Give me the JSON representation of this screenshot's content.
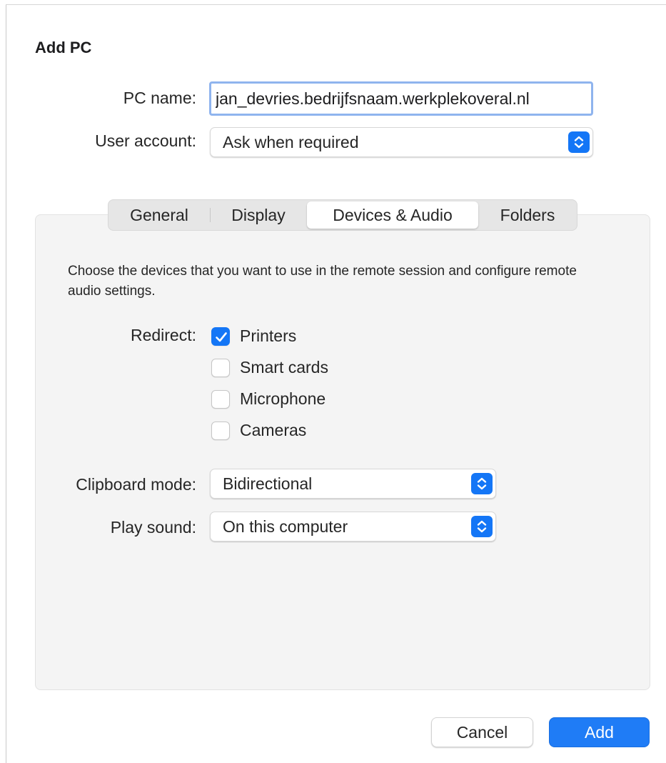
{
  "dialog": {
    "title": "Add PC"
  },
  "pc_name": {
    "label": "PC name:",
    "value": "jan_devries.bedrijfsnaam.werkplekoveral.nl"
  },
  "user_account": {
    "label": "User account:",
    "value": "Ask when required"
  },
  "tabs": [
    {
      "label": "General",
      "active": false
    },
    {
      "label": "Display",
      "active": false
    },
    {
      "label": "Devices & Audio",
      "active": true
    },
    {
      "label": "Folders",
      "active": false
    }
  ],
  "devices": {
    "description": "Choose the devices that you want to use in the remote session and configure remote audio settings.",
    "redirect_label": "Redirect:",
    "options": [
      {
        "label": "Printers",
        "checked": true
      },
      {
        "label": "Smart cards",
        "checked": false
      },
      {
        "label": "Microphone",
        "checked": false
      },
      {
        "label": "Cameras",
        "checked": false
      }
    ],
    "clipboard": {
      "label": "Clipboard mode:",
      "value": "Bidirectional"
    },
    "sound": {
      "label": "Play sound:",
      "value": "On this computer"
    }
  },
  "buttons": {
    "cancel": "Cancel",
    "add": "Add"
  },
  "colors": {
    "accent": "#1476f6",
    "focus_ring": "#8fb4ee",
    "panel": "#f4f4f4"
  }
}
